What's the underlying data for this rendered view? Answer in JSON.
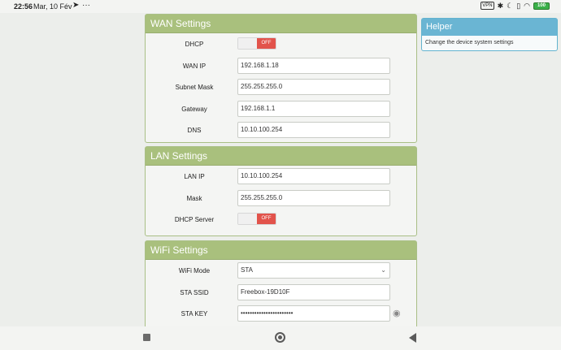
{
  "statusbar": {
    "time": "22:56",
    "date": "Mar, 10 Fév",
    "telegram_icon": "telegram-icon",
    "more": "···",
    "vpn": "VPN",
    "battery": "100"
  },
  "wan": {
    "title": "WAN Settings",
    "dhcp_label": "DHCP",
    "dhcp_toggle": "OFF",
    "wan_ip_label": "WAN IP",
    "wan_ip": "192.168.1.18",
    "subnet_label": "Subnet Mask",
    "subnet": "255.255.255.0",
    "gateway_label": "Gateway",
    "gateway": "192.168.1.1",
    "dns_label": "DNS",
    "dns": "10.10.100.254"
  },
  "lan": {
    "title": "LAN Settings",
    "lan_ip_label": "LAN IP",
    "lan_ip": "10.10.100.254",
    "mask_label": "Mask",
    "mask": "255.255.255.0",
    "dhcp_server_label": "DHCP Server",
    "dhcp_server_toggle": "OFF"
  },
  "wifi": {
    "title": "WiFi Settings",
    "mode_label": "WiFi Mode",
    "mode": "STA",
    "ssid_label": "STA SSID",
    "ssid": "Freebox-19D10F",
    "key_label": "STA KEY",
    "key": "•••••••••••••••••••••••"
  },
  "helper": {
    "title": "Helper",
    "text": "Change the device system settings"
  },
  "colors": {
    "panel_header": "#a9c07d",
    "helper_header": "#6ab5d3",
    "toggle_off": "#e2534b"
  }
}
